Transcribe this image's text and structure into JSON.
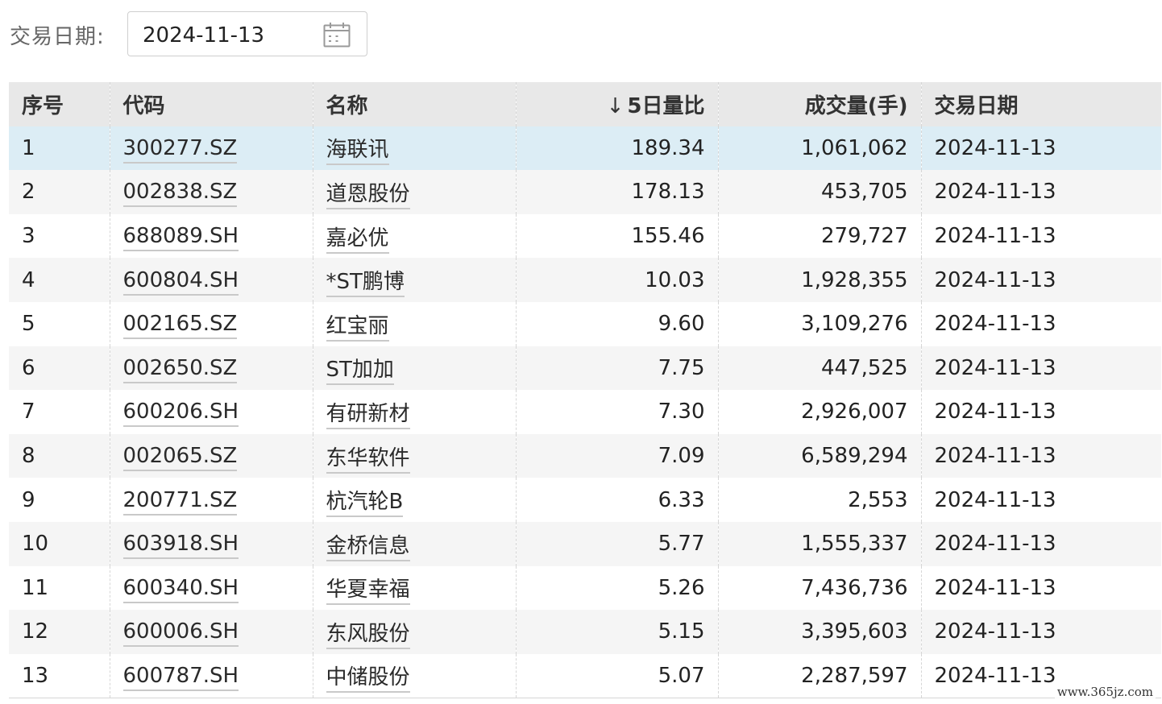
{
  "filter": {
    "label": "交易日期:",
    "date_value": "2024-11-13",
    "icon": "calendar-icon"
  },
  "table": {
    "columns": {
      "index": "序号",
      "code": "代码",
      "name": "名称",
      "sort_arrow": "↓",
      "ratio": "5日量比",
      "volume": "成交量(手)",
      "date": "交易日期"
    },
    "rows": [
      {
        "index": "1",
        "code": "300277.SZ",
        "name": "海联讯",
        "ratio": "189.34",
        "volume": "1,061,062",
        "date": "2024-11-13"
      },
      {
        "index": "2",
        "code": "002838.SZ",
        "name": "道恩股份",
        "ratio": "178.13",
        "volume": "453,705",
        "date": "2024-11-13"
      },
      {
        "index": "3",
        "code": "688089.SH",
        "name": "嘉必优",
        "ratio": "155.46",
        "volume": "279,727",
        "date": "2024-11-13"
      },
      {
        "index": "4",
        "code": "600804.SH",
        "name": "*ST鹏博",
        "ratio": "10.03",
        "volume": "1,928,355",
        "date": "2024-11-13"
      },
      {
        "index": "5",
        "code": "002165.SZ",
        "name": "红宝丽",
        "ratio": "9.60",
        "volume": "3,109,276",
        "date": "2024-11-13"
      },
      {
        "index": "6",
        "code": "002650.SZ",
        "name": "ST加加",
        "ratio": "7.75",
        "volume": "447,525",
        "date": "2024-11-13"
      },
      {
        "index": "7",
        "code": "600206.SH",
        "name": "有研新材",
        "ratio": "7.30",
        "volume": "2,926,007",
        "date": "2024-11-13"
      },
      {
        "index": "8",
        "code": "002065.SZ",
        "name": "东华软件",
        "ratio": "7.09",
        "volume": "6,589,294",
        "date": "2024-11-13"
      },
      {
        "index": "9",
        "code": "200771.SZ",
        "name": "杭汽轮B",
        "ratio": "6.33",
        "volume": "2,553",
        "date": "2024-11-13"
      },
      {
        "index": "10",
        "code": "603918.SH",
        "name": "金桥信息",
        "ratio": "5.77",
        "volume": "1,555,337",
        "date": "2024-11-13"
      },
      {
        "index": "11",
        "code": "600340.SH",
        "name": "华夏幸福",
        "ratio": "5.26",
        "volume": "7,436,736",
        "date": "2024-11-13"
      },
      {
        "index": "12",
        "code": "600006.SH",
        "name": "东风股份",
        "ratio": "5.15",
        "volume": "3,395,603",
        "date": "2024-11-13"
      },
      {
        "index": "13",
        "code": "600787.SH",
        "name": "中储股份",
        "ratio": "5.07",
        "volume": "2,287,597",
        "date": "2024-11-13"
      }
    ]
  },
  "watermark": "www.365jz.com",
  "colors": {
    "header_bg": "#e8e8e8",
    "highlight_row_bg": "#dcedf5",
    "striped_row_bg": "#f5f5f5"
  }
}
